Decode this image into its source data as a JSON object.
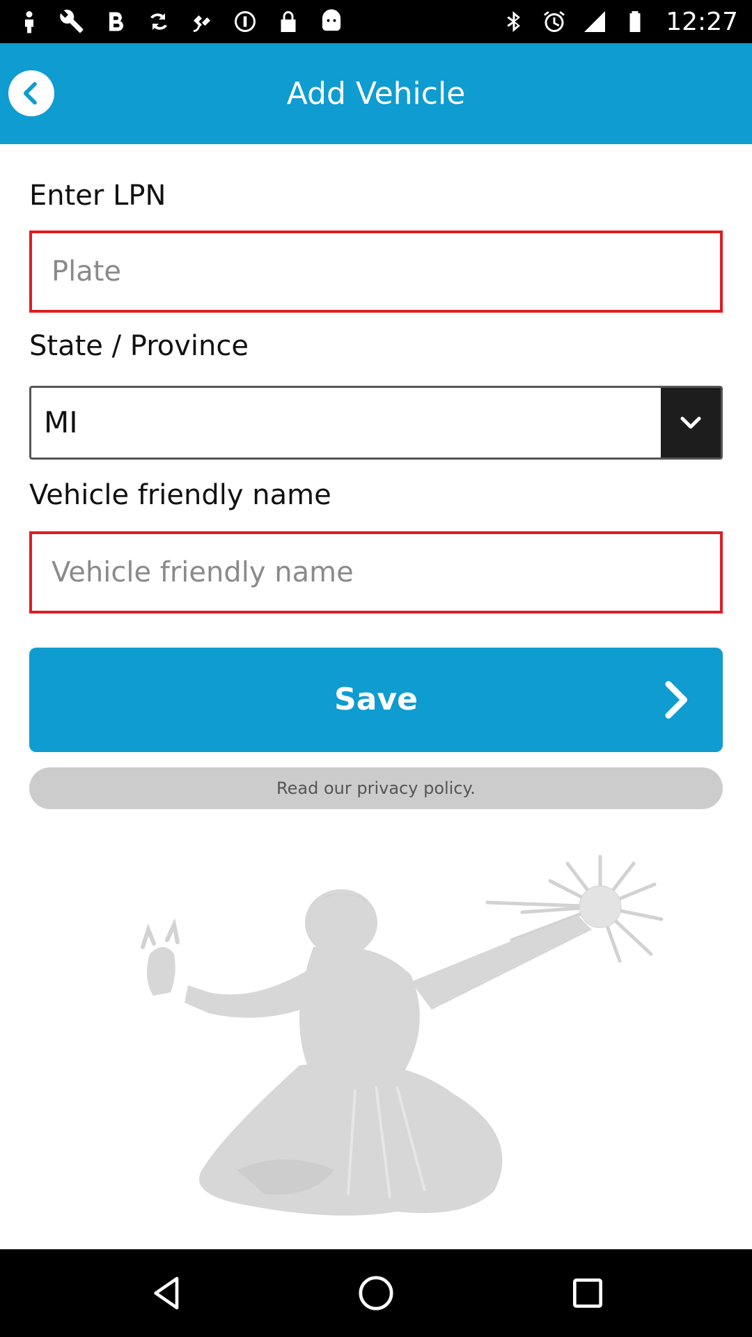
{
  "status_bar": {
    "time": "12:27",
    "left_icons": [
      "person-icon",
      "wrench-icon",
      "bold-b-icon",
      "sync-icon",
      "satellite-fake-gps-icon",
      "notification-icon",
      "lock-icon",
      "android-icon"
    ],
    "right_icons": [
      "bluetooth-icon",
      "alarm-icon",
      "signal-icon",
      "battery-icon"
    ]
  },
  "header": {
    "title": "Add Vehicle",
    "back_icon": "chevron-left-icon",
    "color": "#0f9cd0"
  },
  "form": {
    "lpn": {
      "label": "Enter LPN",
      "placeholder": "Plate",
      "value": ""
    },
    "state": {
      "label": "State / Province",
      "value": "MI",
      "dropdown_icon": "chevron-down-icon"
    },
    "friendly_name": {
      "label": "Vehicle friendly name",
      "placeholder": "Vehicle friendly name",
      "value": ""
    },
    "error_border_color": "#e01c22"
  },
  "actions": {
    "save_label": "Save",
    "save_icon": "chevron-right-icon",
    "privacy_label": "Read our privacy policy."
  },
  "background": {
    "watermark": "spirit-of-detroit-silhouette"
  },
  "nav_bar": {
    "buttons": [
      "back-triangle-icon",
      "home-circle-icon",
      "recents-square-icon"
    ]
  }
}
